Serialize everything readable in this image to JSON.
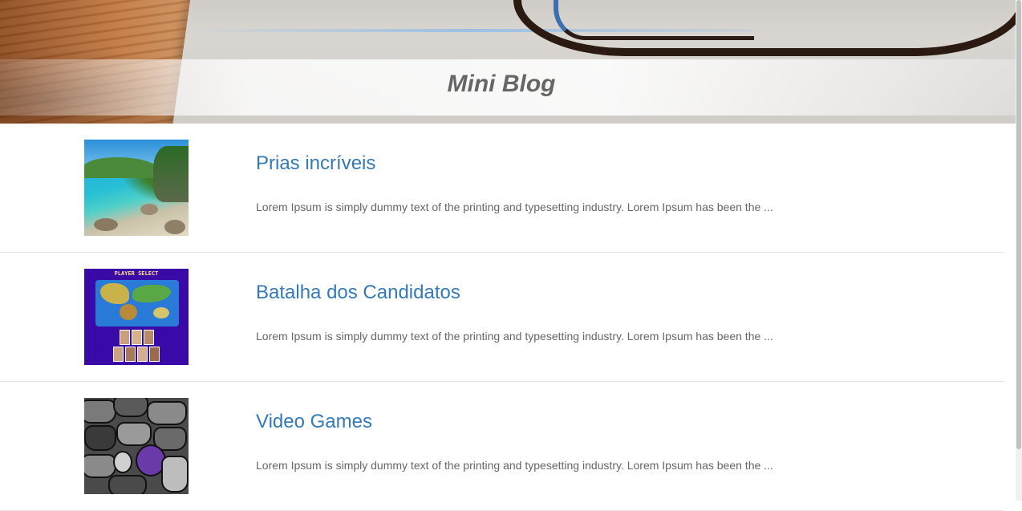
{
  "site": {
    "title": "Mini Blog"
  },
  "posts": [
    {
      "title": "Prias incríveis",
      "excerpt": "Lorem Ipsum is simply dummy text of the printing and typesetting industry. Lorem Ipsum has been the ..."
    },
    {
      "title": "Batalha dos Candidatos",
      "excerpt": "Lorem Ipsum is simply dummy text of the printing and typesetting industry. Lorem Ipsum has been the ...",
      "thumb_caption": "PLAYER SELECT"
    },
    {
      "title": "Video Games",
      "excerpt": "Lorem Ipsum is simply dummy text of the printing and typesetting industry. Lorem Ipsum has been the ..."
    }
  ],
  "colors": {
    "link": "#337ab7",
    "text": "#666666",
    "title": "#666666",
    "divider": "#e5e5e5"
  }
}
